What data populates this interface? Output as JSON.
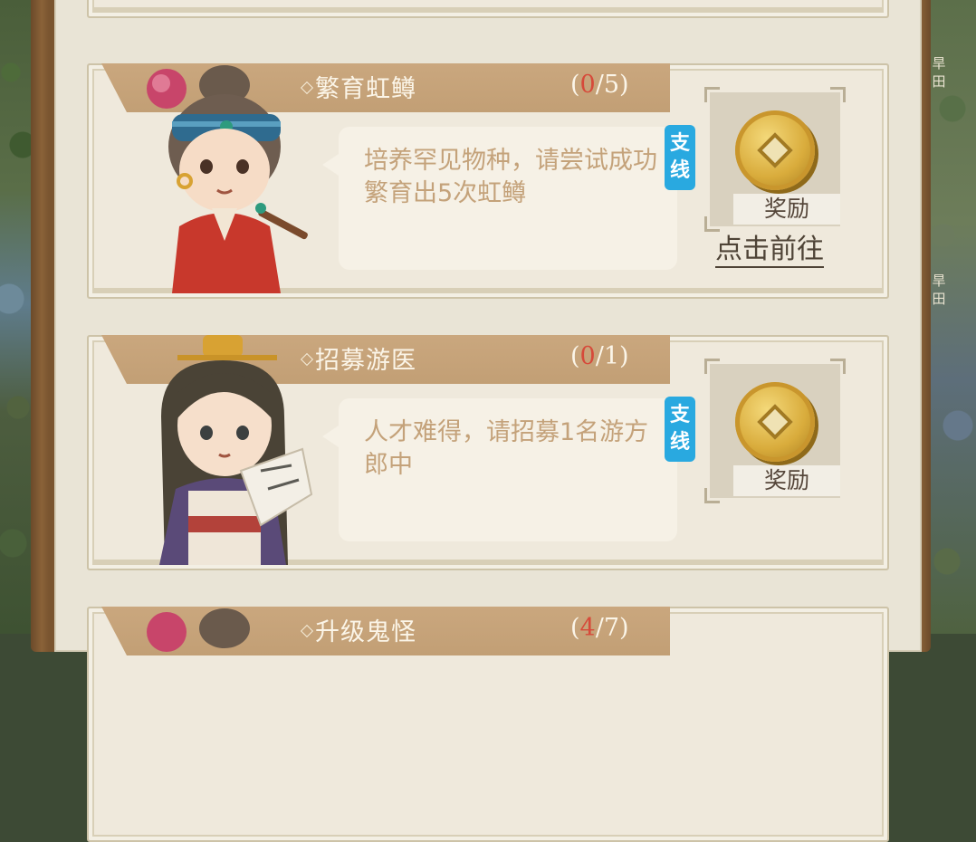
{
  "map": {
    "right_labels": [
      "旱田",
      "旱田"
    ]
  },
  "quests": [
    {
      "title": "繁育虹鳟",
      "progress_current": "0",
      "progress_sep_total": "/5",
      "progress_open": "(",
      "progress_close": ")",
      "description": "培养罕见物种，请尝试成功繁育出5次虹鳟",
      "badge": "支线",
      "reward_label": "奖励",
      "goto_label": "点击前往",
      "reward_icon": "copper-coin-icon"
    },
    {
      "title": "招募游医",
      "progress_current": "0",
      "progress_sep_total": "/1",
      "progress_open": "(",
      "progress_close": ")",
      "description": "人才难得，请招募1名游方郎中",
      "badge": "支线",
      "reward_label": "奖励",
      "reward_icon": "copper-coin-icon"
    },
    {
      "title": "升级鬼怪",
      "progress_current": "4",
      "progress_sep_total": "/7",
      "progress_open": "(",
      "progress_close": ")"
    }
  ],
  "colors": {
    "title_bar": "#c29f75",
    "progress_current": "#d64a3a",
    "badge_blue": "#29a9e0",
    "description_text": "#c4a27a"
  }
}
